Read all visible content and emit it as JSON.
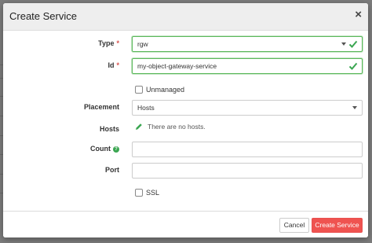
{
  "dialog": {
    "title": "Create Service",
    "close_glyph": "×"
  },
  "form": {
    "type": {
      "label": "Type",
      "required_mark": "*",
      "value": "rgw",
      "valid": true
    },
    "id": {
      "label": "Id",
      "required_mark": "*",
      "value": "my-object-gateway-service",
      "valid": true
    },
    "unmanaged": {
      "label": "Unmanaged",
      "checked": false
    },
    "placement": {
      "label": "Placement",
      "value": "Hosts"
    },
    "hosts": {
      "label": "Hosts",
      "empty_text": "There are no hosts.",
      "icon": "pencil-icon"
    },
    "count": {
      "label": "Count",
      "help_icon": "help-icon",
      "value": ""
    },
    "port": {
      "label": "Port",
      "value": ""
    },
    "ssl": {
      "label": "SSL",
      "checked": false
    }
  },
  "footer": {
    "cancel_label": "Cancel",
    "create_label": "Create Service"
  },
  "colors": {
    "accent_red": "#ef5350",
    "valid_green": "#5cb85c",
    "required_red": "#d9534f",
    "help_green": "#3aa651"
  }
}
